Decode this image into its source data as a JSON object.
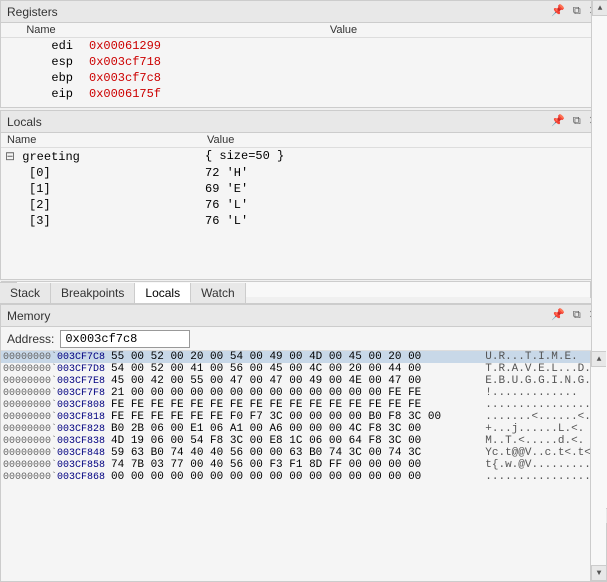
{
  "registers": {
    "title": "Registers",
    "columns": [
      "Name",
      "Value"
    ],
    "rows": [
      {
        "name": "edi",
        "value": "0x00061299"
      },
      {
        "name": "esp",
        "value": "0x003cf718"
      },
      {
        "name": "ebp",
        "value": "0x003cf7c8"
      },
      {
        "name": "eip",
        "value": "0x0006175f"
      }
    ]
  },
  "locals": {
    "title": "Locals",
    "columns": [
      "Name",
      "Value"
    ],
    "rows": [
      {
        "indent": 0,
        "expand": true,
        "name": "greeting",
        "value": "{ size=50 }"
      },
      {
        "indent": 1,
        "name": "[0]",
        "value": "72 'H'"
      },
      {
        "indent": 1,
        "name": "[1]",
        "value": "69 'E'"
      },
      {
        "indent": 1,
        "name": "[2]",
        "value": "76 'L'"
      },
      {
        "indent": 1,
        "name": "[3]",
        "value": "76 'L'"
      }
    ]
  },
  "tabs": [
    "Stack",
    "Breakpoints",
    "Locals",
    "Watch"
  ],
  "active_tab": "Locals",
  "memory": {
    "title": "Memory",
    "address_label": "Address:",
    "address_value": "0x003cf7c8",
    "rows": [
      {
        "addr1": "00000000`",
        "addr2": "003CF7C8",
        "hex": "55 00 52 00 20 00 54 00 49 00 4D 00 45 00 20 00",
        "ascii": "U.R...T.I.M.E. ",
        "highlight": true
      },
      {
        "addr1": "00000000`",
        "addr2": "003CF7D8",
        "hex": "54 00 52 00 41 00 56 00 45 00 4C 00 20 00 44 00",
        "ascii": "T.R.A.V.E.L...D."
      },
      {
        "addr1": "00000000`",
        "addr2": "003CF7E8",
        "hex": "45 00 42 00 55 00 47 00 47 00 49 00 4E 00 47 00",
        "ascii": "E.B.U.G.G.I.N.G."
      },
      {
        "addr1": "00000000`",
        "addr2": "003CF7F8",
        "hex": "21 00 00 00 00 00 00 00 00 00 00 00 00 00 FE FE",
        "ascii": "!............."
      },
      {
        "addr1": "00000000`",
        "addr2": "003CF808",
        "hex": "FE FE FE FE FE FE FE FE FE FE FE FE FE FE FE FE",
        "ascii": "................"
      },
      {
        "addr1": "00000000`",
        "addr2": "003CF818",
        "hex": "FE FE FE FE FE FE F0 F7 3C 00 00 00 00 B0 F8 3C 00",
        "ascii": ".......<......<."
      },
      {
        "addr1": "00000000`",
        "addr2": "003CF828",
        "hex": "B0 2B 06 00 E1 06 A1 00 A6 00 00 00 4C F8 3C 00",
        "ascii": "+...j......L.<."
      },
      {
        "addr1": "00000000`",
        "addr2": "003CF838",
        "hex": "4D 19 06 00 54 F8 3C 00 E8 1C 06 00 64 F8 3C 00",
        "ascii": "M..T.<.....d.<."
      },
      {
        "addr1": "00000000`",
        "addr2": "003CF848",
        "hex": "59 63 B0 74 40 40 56 00 00 63 B0 74 3C 00 74 3C",
        "ascii": "Yc.t@@V..c.t<.t<"
      },
      {
        "addr1": "00000000`",
        "addr2": "003CF858",
        "hex": "74 7B 03 77 00 40 56 00 F3 F1 8D FF 00 00 00 00",
        "ascii": "t{.w.@V........."
      },
      {
        "addr1": "00000000`",
        "addr2": "003CF868",
        "hex": "00 00 00 00 00 00 00 00 00 00 00 00 00 00 00 00",
        "ascii": "................"
      }
    ]
  }
}
